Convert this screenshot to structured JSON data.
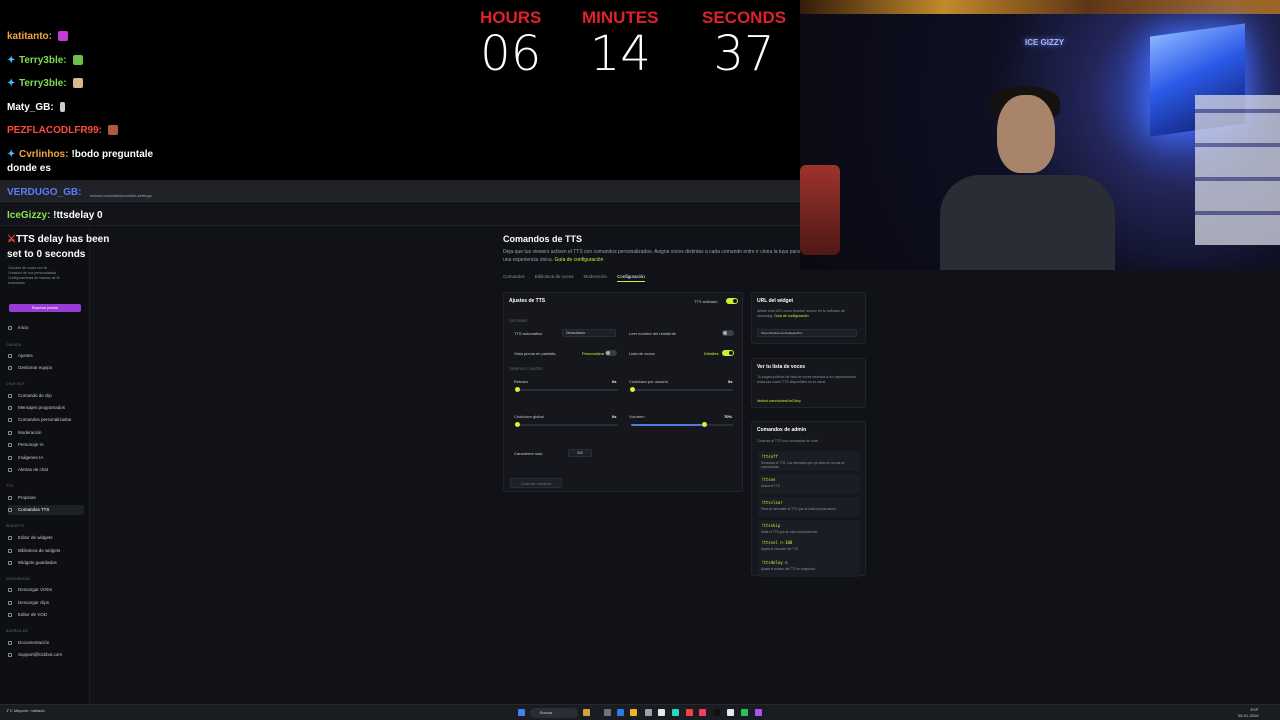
{
  "chat": [
    {
      "user": "katitanto:",
      "text": "",
      "color": "#f2a640"
    },
    {
      "user": "Terry3ble:",
      "text": "",
      "color": "#7fdc4f"
    },
    {
      "user": "Terry3ble:",
      "text": "",
      "color": "#7fdc4f"
    },
    {
      "user": "Maty_GB:",
      "text": "",
      "color": "#ffffff"
    },
    {
      "user": "PEZFLACODLFR99:",
      "text": "",
      "color": "#ff4a3d"
    },
    {
      "user": "Cvrlinhos:",
      "text": "!bodo preguntale",
      "color": "#f2a640"
    },
    {
      "user": "",
      "text": "donde es",
      "color": "#ffffff"
    },
    {
      "user": "VERDUGO_GB:",
      "text": "",
      "color": "#5b7cff"
    },
    {
      "user": "IceGizzy:",
      "text": "!ttsdelay 0",
      "color": "#8ee04f"
    },
    {
      "user": "",
      "text": "TTS delay has been",
      "color": "#ff4a3d"
    },
    {
      "user": "",
      "text": "set to 0 seconds",
      "color": "#ffffff"
    }
  ],
  "countdown": {
    "hours_label": "HOURS",
    "hours": "06",
    "minutes_label": "MINUTES",
    "minutes": "14",
    "seconds_label": "SECONDS",
    "seconds": "37"
  },
  "webcam": {
    "neon_text": "ICE GIZZY"
  },
  "sidebar": {
    "promo": [
      "Clonado de voces con IA",
      "Creación de voz personalizada",
      "Configuraciones de marcas de IA",
      "avanzadas"
    ],
    "promo_button": "Empezar prueba",
    "items": [
      {
        "section": "",
        "label": "Inicio"
      },
      {
        "section": "CUENTA",
        "label": "Ajustes"
      },
      {
        "section": "",
        "label": "Gestionar equipo"
      },
      {
        "section": "CHAT BOT",
        "label": "Comando de clip"
      },
      {
        "section": "",
        "label": "Mensajes programados"
      },
      {
        "section": "",
        "label": "Comandos personalizados"
      },
      {
        "section": "",
        "label": "Moderación"
      },
      {
        "section": "",
        "label": "Personaje IA"
      },
      {
        "section": "",
        "label": "Imágenes IA"
      },
      {
        "section": "",
        "label": "Alertas de chat"
      },
      {
        "section": "TTS",
        "label": "Propinas"
      },
      {
        "section": "",
        "label": "Comandos TTS"
      },
      {
        "section": "WIDGETS",
        "label": "Editor de widgets"
      },
      {
        "section": "",
        "label": "Biblioteca de widgets"
      },
      {
        "section": "",
        "label": "Widgets guardados"
      },
      {
        "section": "DESCARGAS",
        "label": "Descargar VODs"
      },
      {
        "section": "",
        "label": "Descargar clips"
      },
      {
        "section": "",
        "label": "Editor de VOD"
      },
      {
        "section": "ACERCA DE",
        "label": "Documentación"
      },
      {
        "section": "",
        "label": "Support@kickbot.com"
      }
    ]
  },
  "main": {
    "title": "Comandos de TTS",
    "desc": "Deja que tus viewers activen el TTS con comandos personalizados. Asigna voces distintas a cada comando entre ir clona la tuya para una experiencia única.",
    "desc_link": "Guía de configuración",
    "tabs": [
      "Comandos",
      "Biblioteca de voces",
      "Moderación",
      "Configuración"
    ]
  },
  "settings": {
    "title": "Ajustes de TTS",
    "enabled_label": "TTS activado",
    "options_header": "OPCIONES",
    "auto_label": "TTS automático",
    "auto_value": "Desactivado",
    "read_name_label": "Leer nombre del remitente",
    "preview_label": "Vista previa en pantalla",
    "preview_value": "Personalizar",
    "voices_label": "Lista de voces",
    "voices_value": "Detalles",
    "timing_header": "TIEMPOS Y LÍMITES",
    "delay_label": "Retraso",
    "delay_value": "0s",
    "user_cd_label": "Cooldown por usuario",
    "user_cd_value": "0s",
    "global_cd_label": "Cooldown global",
    "global_cd_value": "0s",
    "volume_label": "Volumen",
    "volume_value": "70%",
    "volume": 0.7,
    "max_chars_label": "Caracteres máx.",
    "max_chars_value": "300",
    "save_label": "Guardar cambios"
  },
  "url_card": {
    "title": "URL del widget",
    "desc": "Añade esta URL como browser source en tu software de streaming.",
    "link": "Guía de configuración",
    "url": "https://kickbot.com/widgets/tts/..."
  },
  "voices_card": {
    "title": "Ver tu lista de voces",
    "desc": "Tu página pública de lista de voces muestra a tus espectadores todas las voces TTS disponibles en tu canal.",
    "link": "kickbot.com/voices/IceGizzy"
  },
  "admin_card": {
    "title": "Comandos de admin",
    "desc": "Controla el TTS con comandos de chat.",
    "commands": [
      {
        "code": "!ttsoff",
        "desc": "Desactiva el TTS. Los mensajes que ya están en la cola se reproducirán."
      },
      {
        "code": "!ttson",
        "desc": "Activa el TTS."
      },
      {
        "code": "!ttsclear",
        "desc": "Para de inmediato el TTS que se está reproduciendo."
      },
      {
        "code": "!ttsskip",
        "desc": "Salta el TTS que se está reproduciendo."
      },
      {
        "code": "!ttsvol n-100",
        "desc": "Ajusta el volumen del TTS."
      },
      {
        "code": "!ttsdelay n",
        "desc": "Ajusta el retraso del TTS en segundos."
      }
    ]
  },
  "taskbar": {
    "weather": "1°C Mayorm. nublado",
    "search": "Buscar",
    "time": "ESP",
    "date": "06-01-2026"
  }
}
